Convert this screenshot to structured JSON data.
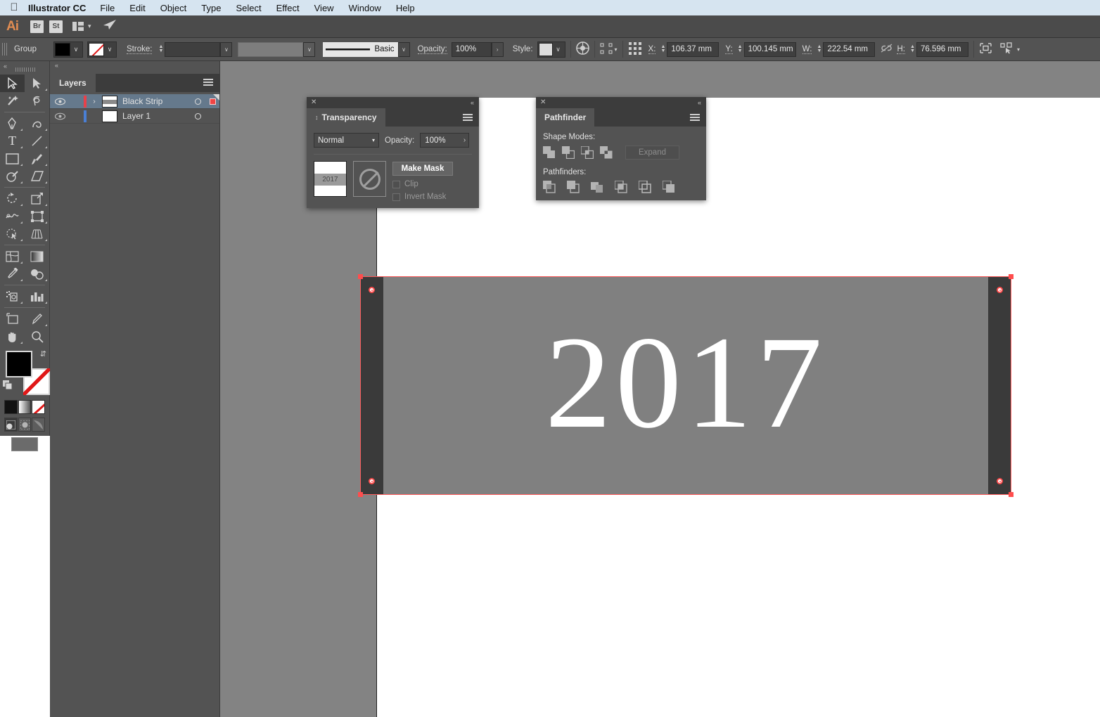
{
  "menubar": {
    "apple_icon": "apple-icon",
    "app_name": "Illustrator CC",
    "items": [
      "File",
      "Edit",
      "Object",
      "Type",
      "Select",
      "Effect",
      "View",
      "Window",
      "Help"
    ]
  },
  "appstrip": {
    "logo": "Ai",
    "bridge": "Br",
    "stock": "St",
    "arrange_icon": "arrange-documents-icon",
    "caret": "∨",
    "plane_icon": "share-icon"
  },
  "controlbar": {
    "selection_type": "Group",
    "fill_label": "fill-swatch",
    "fill_color": "#000000",
    "stroke_swatch": "none-swatch",
    "stroke_label": "Stroke:",
    "stroke_weight": "",
    "brush_name": "Basic",
    "opacity_label": "Opacity:",
    "opacity_value": "100%",
    "style_label": "Style:",
    "x_label": "X:",
    "x_value": "106.37 mm",
    "y_label": "Y:",
    "y_value": "100.145 mm",
    "w_label": "W:",
    "w_value": "222.54 mm",
    "h_label": "H:",
    "h_value": "76.596 mm",
    "link_icon": "unlink-icon",
    "transform_icon": "transform-icon",
    "align_icon": "align-icon",
    "caret": "∨",
    "chevron": "›"
  },
  "tools": [
    {
      "name": "selection-tool",
      "glyph": "➤",
      "selected": true
    },
    {
      "name": "direct-selection-tool",
      "glyph": "➤",
      "selected": false
    },
    {
      "name": "magic-wand-tool",
      "glyph": "✦",
      "selected": false
    },
    {
      "name": "lasso-tool",
      "glyph": "✠",
      "selected": false
    },
    {
      "name": "pen-tool",
      "glyph": "✒",
      "selected": false
    },
    {
      "name": "curvature-tool",
      "glyph": "∿",
      "selected": false
    },
    {
      "name": "type-tool",
      "glyph": "T",
      "selected": false
    },
    {
      "name": "line-segment-tool",
      "glyph": "╱",
      "selected": false
    },
    {
      "name": "rectangle-tool",
      "glyph": "▭",
      "selected": false
    },
    {
      "name": "paintbrush-tool",
      "glyph": "✎",
      "selected": false
    },
    {
      "name": "shaper-tool",
      "glyph": "○",
      "selected": false
    },
    {
      "name": "eraser-tool",
      "glyph": "◆",
      "selected": false
    },
    {
      "name": "rotate-tool",
      "glyph": "↺",
      "selected": false
    },
    {
      "name": "scale-tool",
      "glyph": "⤡",
      "selected": false
    },
    {
      "name": "width-tool",
      "glyph": "∼",
      "selected": false
    },
    {
      "name": "free-transform-tool",
      "glyph": "◳",
      "selected": false
    },
    {
      "name": "shape-builder-tool",
      "glyph": "◔",
      "selected": false
    },
    {
      "name": "perspective-grid-tool",
      "glyph": "◧",
      "selected": false
    },
    {
      "name": "mesh-tool",
      "glyph": "▦",
      "selected": false
    },
    {
      "name": "gradient-tool",
      "glyph": "▨",
      "selected": false
    },
    {
      "name": "eyedropper-tool",
      "glyph": "✐",
      "selected": false
    },
    {
      "name": "blend-tool",
      "glyph": "◎",
      "selected": false
    },
    {
      "name": "symbol-sprayer-tool",
      "glyph": "∷",
      "selected": false
    },
    {
      "name": "column-graph-tool",
      "glyph": "█",
      "selected": false
    },
    {
      "name": "artboard-tool",
      "glyph": "⧉",
      "selected": false
    },
    {
      "name": "slice-tool",
      "glyph": "✄",
      "selected": false
    },
    {
      "name": "hand-tool",
      "glyph": "✋",
      "selected": false
    },
    {
      "name": "zoom-tool",
      "glyph": "⌕",
      "selected": false
    }
  ],
  "layers": {
    "tab_label": "Layers",
    "rows": [
      {
        "name": "Black Strip",
        "color": "#e8414a",
        "selected": true,
        "expandable": true,
        "targeted": true
      },
      {
        "name": "Layer 1",
        "color": "#4a7fd4",
        "selected": false,
        "expandable": false,
        "targeted": false
      }
    ]
  },
  "transparency": {
    "tab_label": "Transparency",
    "blend_mode": "Normal",
    "opacity_label": "Opacity:",
    "opacity_value": "100%",
    "thumbnail_text": "2017",
    "mask_icon": "no-mask-icon",
    "make_mask_label": "Make Mask",
    "clip_label": "Clip",
    "invert_mask_label": "Invert Mask",
    "close_icon": "close-icon",
    "collapse_icon": "collapse-icon",
    "menu_icon": "panel-menu-icon"
  },
  "pathfinder": {
    "tab_label": "Pathfinder",
    "shape_modes_label": "Shape Modes:",
    "pathfinders_label": "Pathfinders:",
    "expand_label": "Expand",
    "shape_modes": [
      "unite-icon",
      "minus-front-icon",
      "intersect-icon",
      "exclude-icon"
    ],
    "pathfinders": [
      "divide-icon",
      "trim-icon",
      "merge-icon",
      "crop-icon",
      "outline-icon",
      "minus-back-icon"
    ],
    "close_icon": "close-icon",
    "collapse_icon": "collapse-icon",
    "menu_icon": "panel-menu-icon"
  },
  "canvas": {
    "artwork_text": "2017",
    "selection_color": "#ff5a5a",
    "strip_color": "#808080",
    "strip_end_color": "#3a3a3a"
  }
}
